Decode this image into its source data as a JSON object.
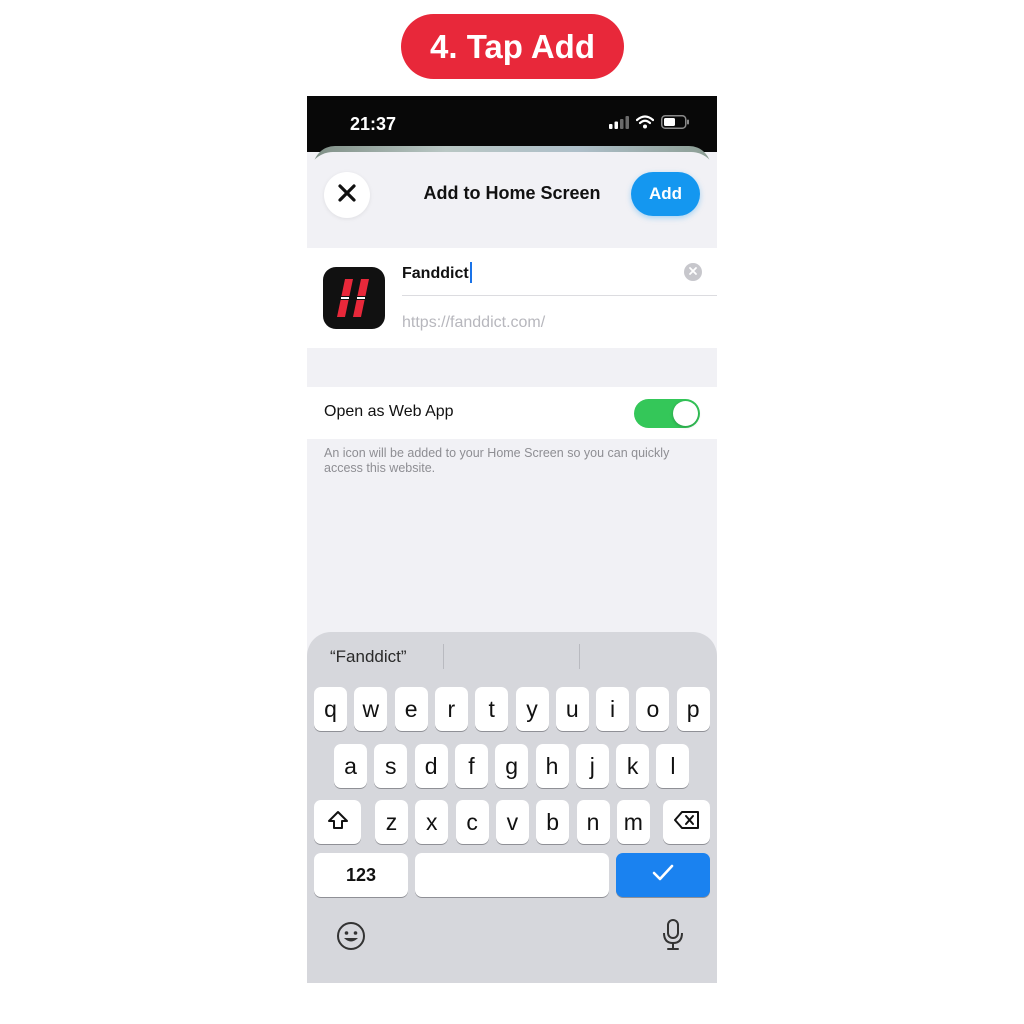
{
  "step_label": "4. Tap Add",
  "status_bar": {
    "time": "21:37"
  },
  "sheet": {
    "title": "Add to Home Screen",
    "add_label": "Add",
    "app_name_value": "Fanddict",
    "url": "https://fanddict.com/",
    "open_as_web_app_label": "Open as Web App",
    "open_as_web_app_enabled": true,
    "description": "An icon will be added to your Home Screen so you can quickly access this website."
  },
  "keyboard": {
    "suggestion": "“Fanddict”",
    "row1": [
      "q",
      "w",
      "e",
      "r",
      "t",
      "y",
      "u",
      "i",
      "o",
      "p"
    ],
    "row2": [
      "a",
      "s",
      "d",
      "f",
      "g",
      "h",
      "j",
      "k",
      "l"
    ],
    "row3": [
      "z",
      "x",
      "c",
      "v",
      "b",
      "n",
      "m"
    ],
    "numbers_label": "123"
  },
  "colors": {
    "step_pill": "#e8283a",
    "add_button": "#1497f0",
    "toggle_on": "#34c759",
    "done_key": "#1a82f0"
  },
  "icons": [
    "signal-icon",
    "wifi-icon",
    "battery-icon",
    "close-icon",
    "clear-icon",
    "shift-icon",
    "backspace-icon",
    "checkmark-icon",
    "emoji-icon",
    "microphone-icon"
  ]
}
